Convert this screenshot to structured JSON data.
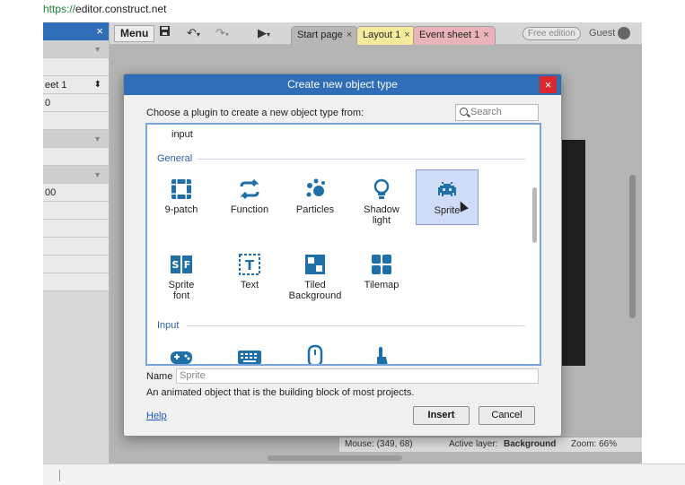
{
  "browser": {
    "url_scheme": "https://",
    "url_host": "editor.construct.net"
  },
  "left_panel": {
    "rows": [
      "",
      "",
      "eet 1",
      "0",
      "",
      "",
      "",
      "",
      "00",
      "",
      "",
      "",
      "",
      ""
    ]
  },
  "toolbar": {
    "menu_label": "Menu",
    "tabs": [
      {
        "label": "Start page",
        "close": "×"
      },
      {
        "label": "Layout 1",
        "close": "×"
      },
      {
        "label": "Event sheet 1",
        "close": "×"
      }
    ],
    "free_edition": "Free edition",
    "user": "Guest"
  },
  "status": {
    "mouse": "Mouse: (349, 68)",
    "active_layer_label": "Active layer:",
    "active_layer_value": "Background",
    "zoom": "Zoom: 66%"
  },
  "dialog": {
    "title": "Create new object type",
    "close": "×",
    "prompt": "Choose a plugin to create a new object type from:",
    "search_placeholder": "Search",
    "first_item": "input",
    "categories": [
      {
        "name": "General",
        "items": [
          {
            "label": "9-patch",
            "icon": "nine-patch-icon"
          },
          {
            "label": "Function",
            "icon": "function-icon"
          },
          {
            "label": "Particles",
            "icon": "particles-icon"
          },
          {
            "label": "Shadow light",
            "icon": "lightbulb-icon"
          },
          {
            "label": "Sprite",
            "icon": "space-invader-icon",
            "selected": true
          },
          {
            "label": "Sprite font",
            "icon": "sprite-font-icon"
          },
          {
            "label": "Text",
            "icon": "text-icon"
          },
          {
            "label": "Tiled Background",
            "icon": "tiled-background-icon"
          },
          {
            "label": "Tilemap",
            "icon": "tilemap-icon"
          }
        ]
      },
      {
        "name": "Input",
        "items": [
          {
            "label": "",
            "icon": "gamepad-icon"
          },
          {
            "label": "",
            "icon": "keyboard-icon"
          },
          {
            "label": "",
            "icon": "mouse-icon"
          },
          {
            "label": "",
            "icon": "touch-icon"
          }
        ]
      }
    ],
    "name_label": "Name",
    "name_value": "Sprite",
    "description": "An animated object that is the building block of most projects.",
    "help_label": "Help",
    "insert_label": "Insert",
    "cancel_label": "Cancel"
  },
  "colors": {
    "accent": "#2f6db6",
    "icon": "#1f6fa8",
    "close": "#d9272e",
    "selection": "#cfdcf7"
  }
}
